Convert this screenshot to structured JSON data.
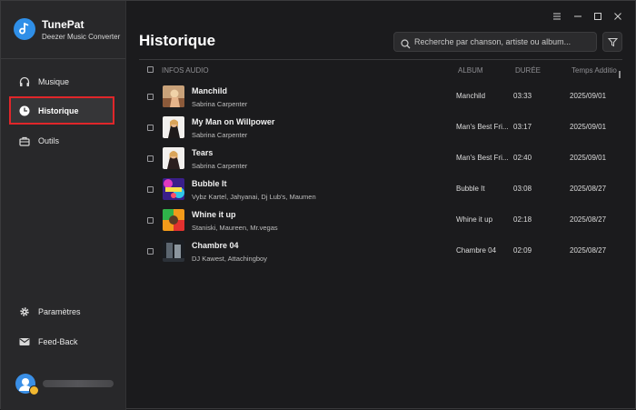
{
  "app": {
    "name": "TunePat",
    "subtitle": "Deezer Music Converter"
  },
  "sidebar": {
    "items": [
      {
        "label": "Musique",
        "icon": "headphones-icon"
      },
      {
        "label": "Historique",
        "icon": "clock-icon",
        "active": true
      },
      {
        "label": "Outils",
        "icon": "toolbox-icon"
      }
    ],
    "bottom_items": [
      {
        "label": "Paramètres",
        "icon": "gear-icon"
      },
      {
        "label": "Feed-Back",
        "icon": "mail-icon"
      }
    ]
  },
  "header": {
    "title": "Historique",
    "search_placeholder": "Recherche par chanson, artiste ou album..."
  },
  "table": {
    "columns": {
      "info": "INFOS AUDIO",
      "album": "ALBUM",
      "duration": "DURÉE",
      "added": "Temps Addition..."
    },
    "rows": [
      {
        "title": "Manchild",
        "artist": "Sabrina Carpenter",
        "album": "Manchild",
        "duration": "03:33",
        "date": "2025/09/01"
      },
      {
        "title": "My Man on Willpower",
        "artist": "Sabrina Carpenter",
        "album": "Man's Best Fri...",
        "duration": "03:17",
        "date": "2025/09/01"
      },
      {
        "title": "Tears",
        "artist": "Sabrina Carpenter",
        "album": "Man's Best Fri...",
        "duration": "02:40",
        "date": "2025/09/01"
      },
      {
        "title": "Bubble It",
        "artist": "Vybz Kartel, Jahyanai, Dj Lub's, Maumen",
        "album": "Bubble It",
        "duration": "03:08",
        "date": "2025/08/27"
      },
      {
        "title": "Whine it up",
        "artist": "Staniski, Maureen, Mr.vegas",
        "album": "Whine it up",
        "duration": "02:18",
        "date": "2025/08/27"
      },
      {
        "title": "Chambre 04",
        "artist": "DJ Kawest, Attachingboy",
        "album": "Chambre 04",
        "duration": "02:09",
        "date": "2025/08/27"
      }
    ]
  },
  "colors": {
    "accent": "#2f8fe8",
    "highlight_border": "#e0262a",
    "background": "#1b1b1d",
    "sidebar": "#28282a"
  }
}
